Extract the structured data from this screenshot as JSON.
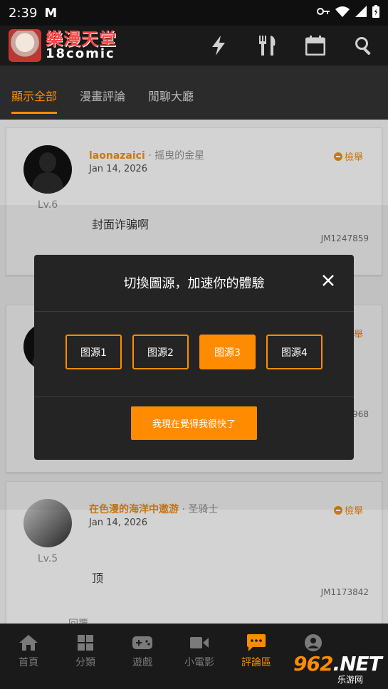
{
  "status": {
    "time": "2:39",
    "app_letter": "M"
  },
  "app": {
    "logo_cn": "樂漫天堂",
    "logo_en": "18comic"
  },
  "tabs": [
    {
      "label": "顯示全部",
      "active": true
    },
    {
      "label": "漫畫評論",
      "active": false
    },
    {
      "label": "閒聊大廳",
      "active": false
    }
  ],
  "comments": [
    {
      "username": "laonazaici",
      "title": "· 摇曳的金星",
      "date": "Jan 14, 2026",
      "level": "Lv.6",
      "report": "檢舉",
      "text": "封面诈骗啊",
      "jm": "JM1247859"
    },
    {
      "report": "檢舉",
      "jm_partial": "968"
    },
    {
      "username": "在色漫的海洋中遨游",
      "title": "· 圣骑士",
      "date": "Jan 14, 2026",
      "level": "Lv.5",
      "report": "檢舉",
      "text": "顶",
      "jm": "JM1173842"
    }
  ],
  "partial_reply": "回覆",
  "dialog": {
    "title": "切換圖源，加速你的體驗",
    "sources": [
      {
        "label": "图源1",
        "active": false
      },
      {
        "label": "图源2",
        "active": false
      },
      {
        "label": "图源3",
        "active": true
      },
      {
        "label": "图源4",
        "active": false
      }
    ],
    "confirm_label": "我現在覺得我很快了"
  },
  "bottom_nav": [
    {
      "label": "首頁",
      "icon": "home-icon",
      "active": false
    },
    {
      "label": "分類",
      "icon": "grid-icon",
      "active": false
    },
    {
      "label": "遊戲",
      "icon": "gamepad-icon",
      "active": false
    },
    {
      "label": "小電影",
      "icon": "video-camera-icon",
      "active": false
    },
    {
      "label": "評論區",
      "icon": "chat-icon",
      "active": true
    },
    {
      "label": "",
      "icon": "user-icon",
      "active": false
    }
  ],
  "watermark": {
    "brand_main": "962",
    "brand_suffix": ".NET",
    "sub": "乐游网"
  },
  "colors": {
    "accent": "#ff8c00",
    "username": "#e38a1b"
  }
}
